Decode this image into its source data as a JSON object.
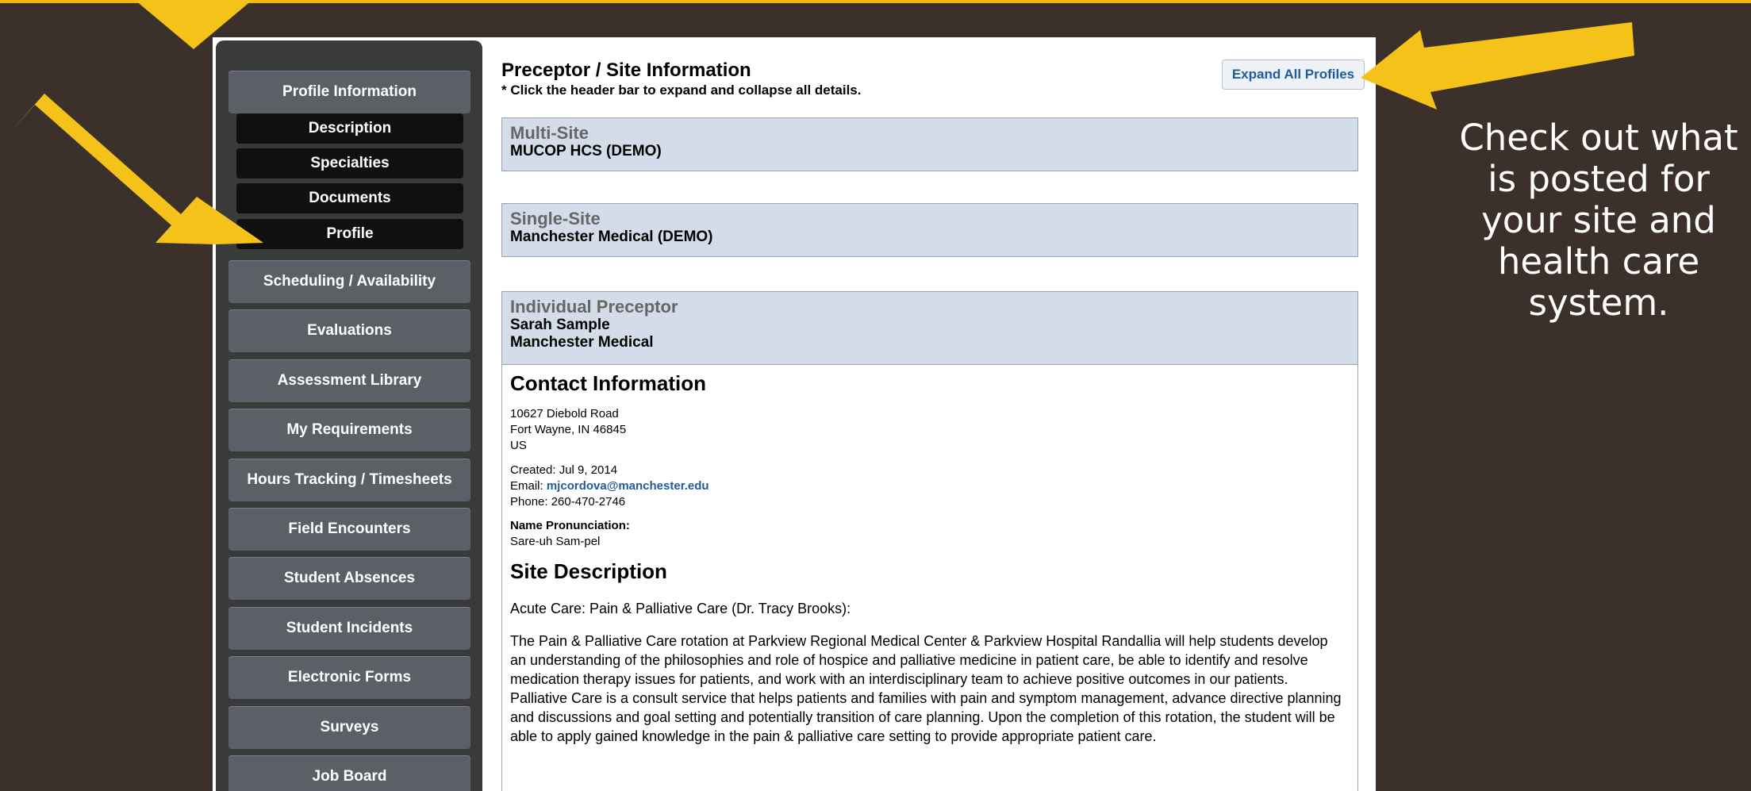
{
  "sidebar": {
    "profile_information": "Profile Information",
    "sub_items": [
      "Description",
      "Specialties",
      "Documents",
      "Profile"
    ],
    "items": [
      "Scheduling / Availability",
      "Evaluations",
      "Assessment Library",
      "My Requirements",
      "Hours Tracking / Timesheets",
      "Field Encounters",
      "Student Absences",
      "Student Incidents",
      "Electronic Forms",
      "Surveys",
      "Job Board"
    ]
  },
  "main": {
    "title": "Preceptor / Site Information",
    "hint": "* Click the header bar to expand and collapse all details.",
    "expand_button": "Expand All Profiles",
    "profiles": [
      {
        "label": "Multi-Site",
        "lines": [
          "MUCOP HCS (DEMO)"
        ]
      },
      {
        "label": "Single-Site",
        "lines": [
          "Manchester Medical (DEMO)"
        ]
      },
      {
        "label": "Individual Preceptor",
        "lines": [
          "Sarah Sample",
          "Manchester Medical"
        ]
      }
    ],
    "contact": {
      "title": "Contact Information",
      "address": [
        "10627 Diebold Road",
        "Fort Wayne, IN 46845",
        "US"
      ],
      "created": "Created: Jul 9, 2014",
      "email_label": "Email: ",
      "email": "mjcordova@manchester.edu",
      "phone": "Phone: 260-470-2746",
      "pronunciation_label": "Name Pronunciation:",
      "pronunciation": "Sare-uh Sam-pel"
    },
    "site_description": {
      "title": "Site Description",
      "heading": "Acute Care:  Pain & Palliative Care (Dr. Tracy Brooks):",
      "body": "The Pain & Palliative Care rotation at Parkview Regional Medical Center & Parkview Hospital Randallia will help students develop an understanding of the philosophies and role of hospice and palliative medicine in patient care, be able to identify and resolve medication therapy issues for patients, and work with an interdisciplinary team to achieve positive outcomes in our patients. Palliative Care is a consult service that helps patients and families with pain and symptom management, advance directive planning and discussions and goal setting and potentially transition of care planning. Upon the completion of this rotation, the student will be able to apply gained knowledge in the pain & palliative care setting to provide appropriate patient care."
    }
  },
  "callout": {
    "lines": [
      "Check out what",
      "is posted for",
      "your site and",
      "health care",
      "system."
    ]
  },
  "colors": {
    "background": "#3b312a",
    "accent": "#f0b90f",
    "link": "#1f5c9b",
    "profile_header": "#d3dce8"
  }
}
